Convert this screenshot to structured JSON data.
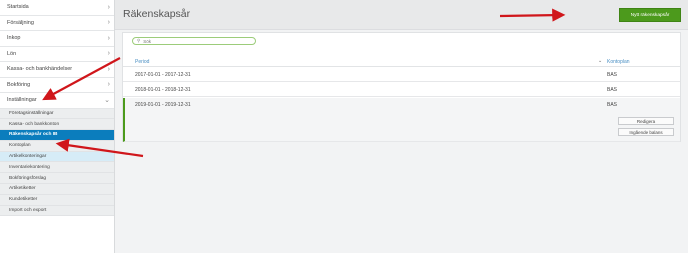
{
  "sidebar": {
    "items": [
      {
        "label": "Startsida"
      },
      {
        "label": "Försäljning"
      },
      {
        "label": "Inkop"
      },
      {
        "label": "Lön"
      },
      {
        "label": "Kassa- och bankhändelser"
      },
      {
        "label": "Bokföring"
      },
      {
        "label": "Inställningar"
      }
    ],
    "sub_items": [
      {
        "label": "Företagsinställningar"
      },
      {
        "label": "Kassa- och bankkonton"
      },
      {
        "label": "Räkenskapsår och IB"
      },
      {
        "label": "Kontoplan"
      },
      {
        "label": "Artikelkonteringar"
      },
      {
        "label": "Inventariekontering"
      },
      {
        "label": "Bokföringsförslag"
      },
      {
        "label": "Artiketiketter"
      },
      {
        "label": "Kundetiketter"
      },
      {
        "label": "Import och export"
      }
    ]
  },
  "header": {
    "title": "Räkenskapsår",
    "new_button": "Nytt räkenskapsår"
  },
  "search": {
    "placeholder": "Sök"
  },
  "table": {
    "columns": [
      "Period",
      "Kontoplan"
    ],
    "rows": [
      {
        "period": "2017-01-01 - 2017-12-31",
        "kontoplan": "BAS"
      },
      {
        "period": "2018-01-01 - 2018-12-31",
        "kontoplan": "BAS"
      },
      {
        "period": "2019-01-01 - 2019-12-31",
        "kontoplan": "BAS"
      }
    ],
    "actions": {
      "edit": "Redigera",
      "opening_balance": "Ingående balans"
    }
  },
  "colors": {
    "accent_green": "#4c9a1c",
    "active_blue": "#0b7dbd",
    "annotation_red": "#d0161b"
  }
}
